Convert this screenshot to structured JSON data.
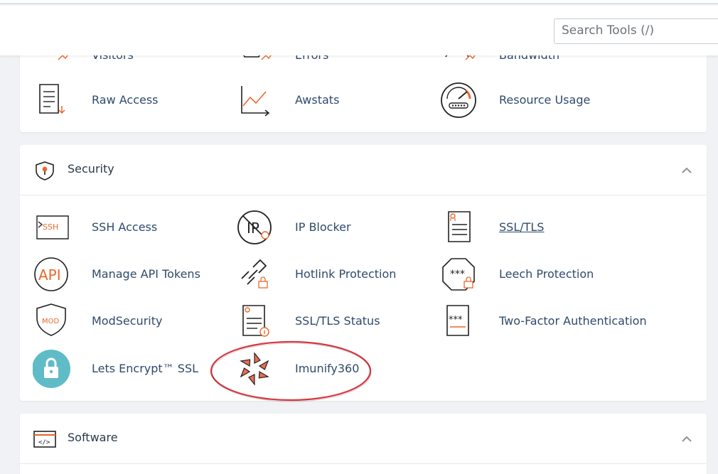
{
  "search": {
    "placeholder": "Search Tools (/)"
  },
  "metrics_partial": [
    {
      "label": "Visitors",
      "icon": "visitors-icon"
    },
    {
      "label": "Errors",
      "icon": "errors-icon"
    },
    {
      "label": "Bandwidth",
      "icon": "bandwidth-icon"
    }
  ],
  "metrics": [
    {
      "label": "Raw Access",
      "icon": "raw-access-icon"
    },
    {
      "label": "Awstats",
      "icon": "awstats-icon"
    },
    {
      "label": "Resource Usage",
      "icon": "resource-usage-icon"
    }
  ],
  "security": {
    "title": "Security",
    "tools": [
      {
        "label": "SSH Access",
        "icon": "ssh-access-icon"
      },
      {
        "label": "IP Blocker",
        "icon": "ip-blocker-icon"
      },
      {
        "label": "SSL/TLS",
        "icon": "ssl-tls-icon"
      },
      {
        "label": "Manage API Tokens",
        "icon": "api-tokens-icon"
      },
      {
        "label": "Hotlink Protection",
        "icon": "hotlink-protection-icon"
      },
      {
        "label": "Leech Protection",
        "icon": "leech-protection-icon"
      },
      {
        "label": "ModSecurity",
        "icon": "modsecurity-icon"
      },
      {
        "label": "SSL/TLS Status",
        "icon": "ssl-tls-status-icon"
      },
      {
        "label": "Two-Factor Authentication",
        "icon": "two-factor-icon"
      },
      {
        "label": "Lets Encrypt™ SSL",
        "icon": "lets-encrypt-icon"
      },
      {
        "label": "Imunify360",
        "icon": "imunify360-icon"
      }
    ]
  },
  "software": {
    "title": "Software"
  },
  "colors": {
    "accent": "#e8692c",
    "link": "#2f4a6b",
    "highlight_ring": "#d9363e"
  }
}
